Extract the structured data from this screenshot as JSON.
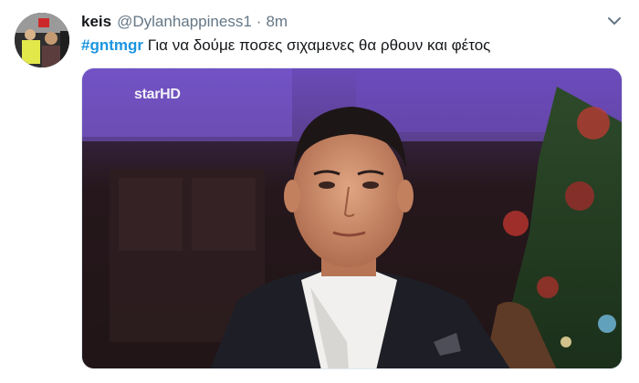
{
  "tweet": {
    "display_name": "keis",
    "handle": "@Dylanhappiness1",
    "separator": "·",
    "time": "8m",
    "hashtag": "#gntmgr",
    "text": "Για να δούμε ποσες  σιχαμενες θα ρθουν και φέτος"
  },
  "media": {
    "channel_logo": "starHD"
  },
  "icons": {
    "menu": "chevron-down-icon"
  },
  "colors": {
    "link": "#1b95e0",
    "text": "#14171a",
    "secondary": "#657786"
  }
}
